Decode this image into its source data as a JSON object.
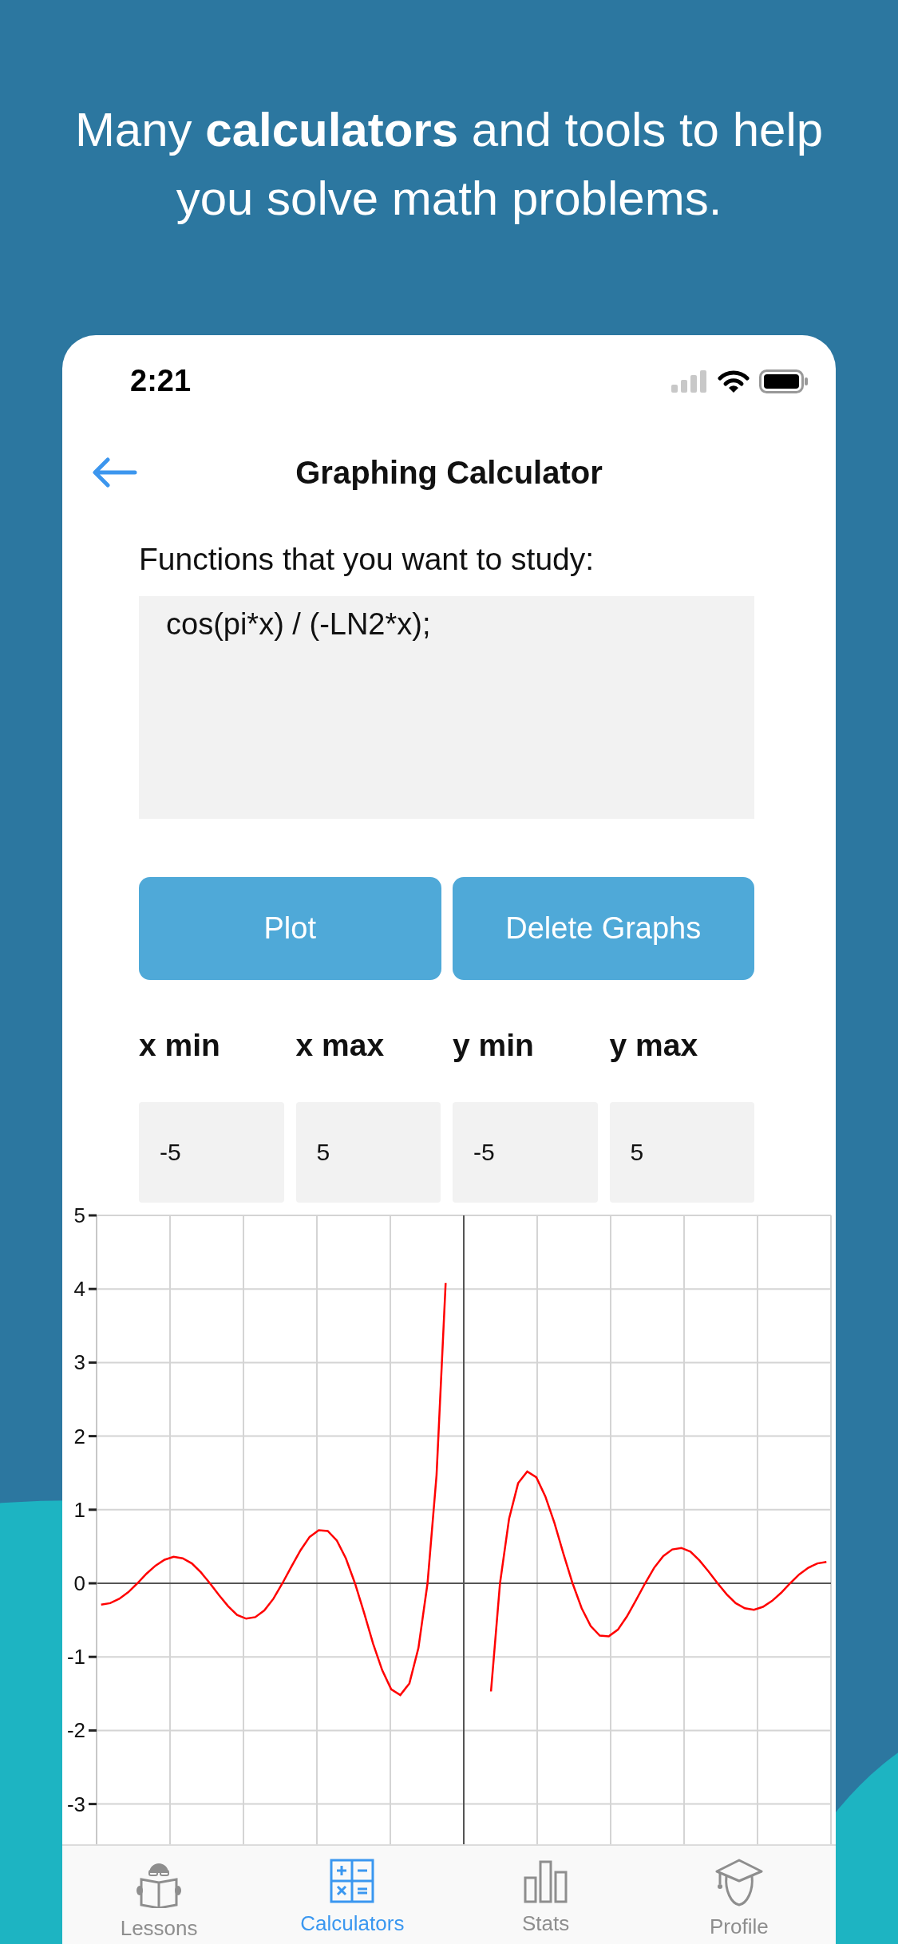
{
  "headline": "Many **calculators** and tools to help you solve math problems.",
  "status_bar": {
    "time": "2:21"
  },
  "nav": {
    "title": "Graphing Calculator"
  },
  "functions": {
    "label": "Functions that you want to study:",
    "value": "cos(pi*x) / (-LN2*x);"
  },
  "buttons": [
    {
      "label": "Plot"
    },
    {
      "label": "Delete Graphs"
    }
  ],
  "range_fields": [
    {
      "label": "x min",
      "value": "-5"
    },
    {
      "label": "x max",
      "value": "5"
    },
    {
      "label": "y min",
      "value": "-5"
    },
    {
      "label": "y max",
      "value": "5"
    }
  ],
  "graph": {
    "chart_data": {
      "type": "line",
      "grid": true,
      "ylim": [
        -5,
        5
      ],
      "yticks": [
        -3,
        -2,
        -1,
        0,
        1,
        2,
        3,
        4,
        5
      ],
      "categories": [
        null,
        null,
        null,
        null,
        null,
        null,
        null,
        null,
        null,
        null,
        null,
        null,
        null,
        null,
        null,
        null,
        null,
        null,
        null,
        null,
        null,
        null,
        null,
        null,
        null,
        null,
        null,
        null,
        null,
        null,
        null,
        null,
        null,
        null,
        null,
        null,
        null,
        null,
        null,
        null,
        null,
        null,
        null,
        null,
        null,
        null,
        null,
        null,
        null,
        null,
        null,
        null,
        null,
        null,
        null,
        null,
        null,
        null,
        null,
        null,
        null,
        null,
        null,
        null,
        null,
        null,
        null,
        null,
        null,
        null,
        null,
        null,
        null,
        null,
        null,
        null,
        null,
        null,
        null,
        null,
        null
      ],
      "series": [
        {
          "color": "#ff0000",
          "values": [
            -0.29,
            -0.27,
            -0.21,
            -0.12,
            0,
            0.13,
            0.24,
            0.32,
            0.36,
            0.34,
            0.27,
            0.15,
            0,
            -0.16,
            -0.31,
            -0.43,
            -0.48,
            -0.46,
            -0.37,
            -0.21,
            0,
            0.23,
            0.45,
            0.63,
            0.72,
            0.71,
            0.58,
            0.34,
            0,
            -0.4,
            -0.82,
            -1.18,
            -1.44,
            -1.52,
            -1.36,
            -0.88,
            0,
            1.47,
            4.08,
            null,
            null,
            null,
            null,
            -1.47,
            0,
            0.88,
            1.36,
            1.52,
            1.44,
            1.18,
            0.82,
            0.4,
            0,
            -0.34,
            -0.58,
            -0.71,
            -0.72,
            -0.63,
            -0.45,
            -0.23,
            0,
            0.21,
            0.37,
            0.46,
            0.48,
            0.43,
            0.31,
            0.16,
            0,
            -0.15,
            -0.27,
            -0.34,
            -0.36,
            -0.32,
            -0.24,
            -0.13,
            0,
            0.12,
            0.21,
            0.27,
            0.29
          ]
        }
      ]
    }
  },
  "tabs": [
    {
      "label": "Lessons",
      "selected": false,
      "kind": "reader"
    },
    {
      "label": "Calculators",
      "selected": true,
      "kind": "calculator"
    },
    {
      "label": "Stats",
      "selected": false,
      "kind": "stats"
    },
    {
      "label": "Profile",
      "selected": false,
      "kind": "graduate"
    }
  ]
}
